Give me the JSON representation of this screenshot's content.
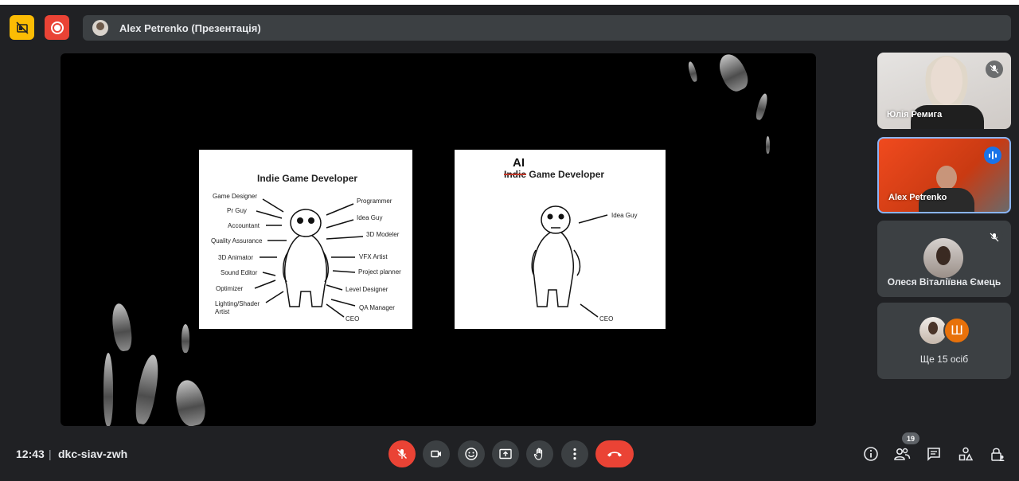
{
  "header": {
    "presenter_label": "Alex Petrenko (Презентація)",
    "icons": {
      "left": "hide-tiles-icon",
      "record": "recording-icon"
    }
  },
  "slides": {
    "left": {
      "title": "Indie Game Developer",
      "labels_left": [
        "Game Designer",
        "Pr Guy",
        "Accountant",
        "Quality Assurance",
        "3D Animator",
        "Sound Editor",
        "Optimizer",
        "Lighting/Shader",
        "Artist"
      ],
      "labels_right": [
        "Programmer",
        "Idea Guy",
        "3D Modeler",
        "VFX Artist",
        "Project planner",
        "Level Designer",
        "QA Manager",
        "CEO"
      ]
    },
    "right": {
      "ai": "AI",
      "struck": "Indie",
      "title_rest": "Game Developer",
      "label_idea": "Idea Guy",
      "label_ceo": "CEO"
    }
  },
  "participants": [
    {
      "name": "Юлія Ремига",
      "muted": true
    },
    {
      "name": "Alex Petrenko",
      "speaking": true
    },
    {
      "name": "Олеся Віталіївна Ємець",
      "muted": true
    },
    {
      "letter": "Ш",
      "more_label": "Ще 15 осіб"
    }
  ],
  "footer": {
    "time": "12:43",
    "separator": "|",
    "meeting_code": "dkc-siav-zwh",
    "participant_count": "19",
    "colors": {
      "end_call": "#ea4335",
      "mic_off": "#ea4335",
      "accent": "#8ab4f8"
    }
  }
}
